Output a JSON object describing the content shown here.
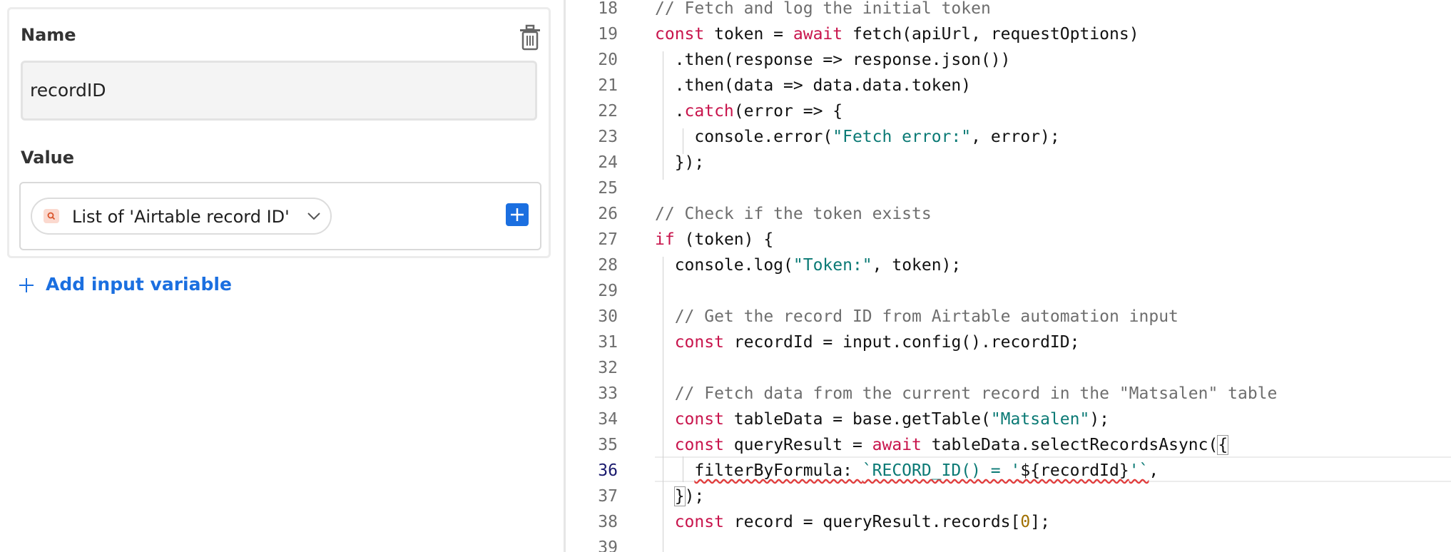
{
  "left_panel": {
    "name_label": "Name",
    "name_value": "recordID",
    "value_label": "Value",
    "value_pill": "List of 'Airtable record ID'",
    "add_input_variable": "Add input variable"
  },
  "colors": {
    "accent": "#1b6fe0",
    "keyword": "#c8144c",
    "string": "#0b7a75",
    "comment": "#6e6e6e",
    "number": "#a07000"
  },
  "editor": {
    "active_line": 36,
    "lines": [
      {
        "n": "18",
        "tokens": [
          {
            "t": "// Fetch and log the initial token",
            "c": "cm"
          }
        ]
      },
      {
        "n": "19",
        "tokens": [
          {
            "t": "const",
            "c": "kw"
          },
          {
            "t": " token = "
          },
          {
            "t": "await",
            "c": "kw"
          },
          {
            "t": " fetch(apiUrl, requestOptions)"
          }
        ]
      },
      {
        "n": "20",
        "tokens": [
          {
            "t": "  .then(response => response.json())"
          }
        ]
      },
      {
        "n": "21",
        "tokens": [
          {
            "t": "  .then(data => data.data.token)"
          }
        ]
      },
      {
        "n": "22",
        "tokens": [
          {
            "t": "  ."
          },
          {
            "t": "catch",
            "c": "kw"
          },
          {
            "t": "(error => {"
          }
        ]
      },
      {
        "n": "23",
        "tokens": [
          {
            "t": "    console.error("
          },
          {
            "t": "\"Fetch error:\"",
            "c": "str"
          },
          {
            "t": ", error);"
          }
        ]
      },
      {
        "n": "24",
        "tokens": [
          {
            "t": "  });"
          }
        ]
      },
      {
        "n": "25",
        "tokens": []
      },
      {
        "n": "26",
        "tokens": [
          {
            "t": "// Check if the token exists",
            "c": "cm"
          }
        ]
      },
      {
        "n": "27",
        "tokens": [
          {
            "t": "if",
            "c": "kw"
          },
          {
            "t": " (token) {"
          }
        ]
      },
      {
        "n": "28",
        "tokens": [
          {
            "t": "  console.log("
          },
          {
            "t": "\"Token:\"",
            "c": "str"
          },
          {
            "t": ", token);"
          }
        ]
      },
      {
        "n": "29",
        "tokens": []
      },
      {
        "n": "30",
        "tokens": [
          {
            "t": "  // Get the record ID from Airtable automation input",
            "c": "cm"
          }
        ]
      },
      {
        "n": "31",
        "tokens": [
          {
            "t": "  "
          },
          {
            "t": "const",
            "c": "kw"
          },
          {
            "t": " recordId = input.config().recordID;"
          }
        ]
      },
      {
        "n": "32",
        "tokens": []
      },
      {
        "n": "33",
        "tokens": [
          {
            "t": "  // Fetch data from the current record in the \"Matsalen\" table",
            "c": "cm"
          }
        ]
      },
      {
        "n": "34",
        "tokens": [
          {
            "t": "  "
          },
          {
            "t": "const",
            "c": "kw"
          },
          {
            "t": " tableData = base.getTable("
          },
          {
            "t": "\"Matsalen\"",
            "c": "str"
          },
          {
            "t": ");"
          }
        ]
      },
      {
        "n": "35",
        "tokens": [
          {
            "t": "  "
          },
          {
            "t": "const",
            "c": "kw"
          },
          {
            "t": " queryResult = "
          },
          {
            "t": "await",
            "c": "kw"
          },
          {
            "t": " tableData.selectRecordsAsync("
          },
          {
            "t": "{",
            "c": "br"
          }
        ]
      },
      {
        "n": "36",
        "tokens": [
          {
            "t": "    "
          },
          {
            "t": "filterByFormula: ",
            "c": "sq"
          },
          {
            "t": "`RECORD_ID() = '",
            "c": "str sq"
          },
          {
            "t": "${recordId}",
            "c": "sq"
          },
          {
            "t": "'`",
            "c": "str sq"
          },
          {
            "t": ","
          }
        ]
      },
      {
        "n": "37",
        "tokens": [
          {
            "t": "  "
          },
          {
            "t": "}",
            "c": "br"
          },
          {
            "t": ");"
          }
        ]
      },
      {
        "n": "38",
        "tokens": [
          {
            "t": "  "
          },
          {
            "t": "const",
            "c": "kw"
          },
          {
            "t": " record = queryResult.records["
          },
          {
            "t": "0",
            "c": "num"
          },
          {
            "t": "];"
          }
        ]
      },
      {
        "n": "39",
        "tokens": []
      }
    ]
  }
}
